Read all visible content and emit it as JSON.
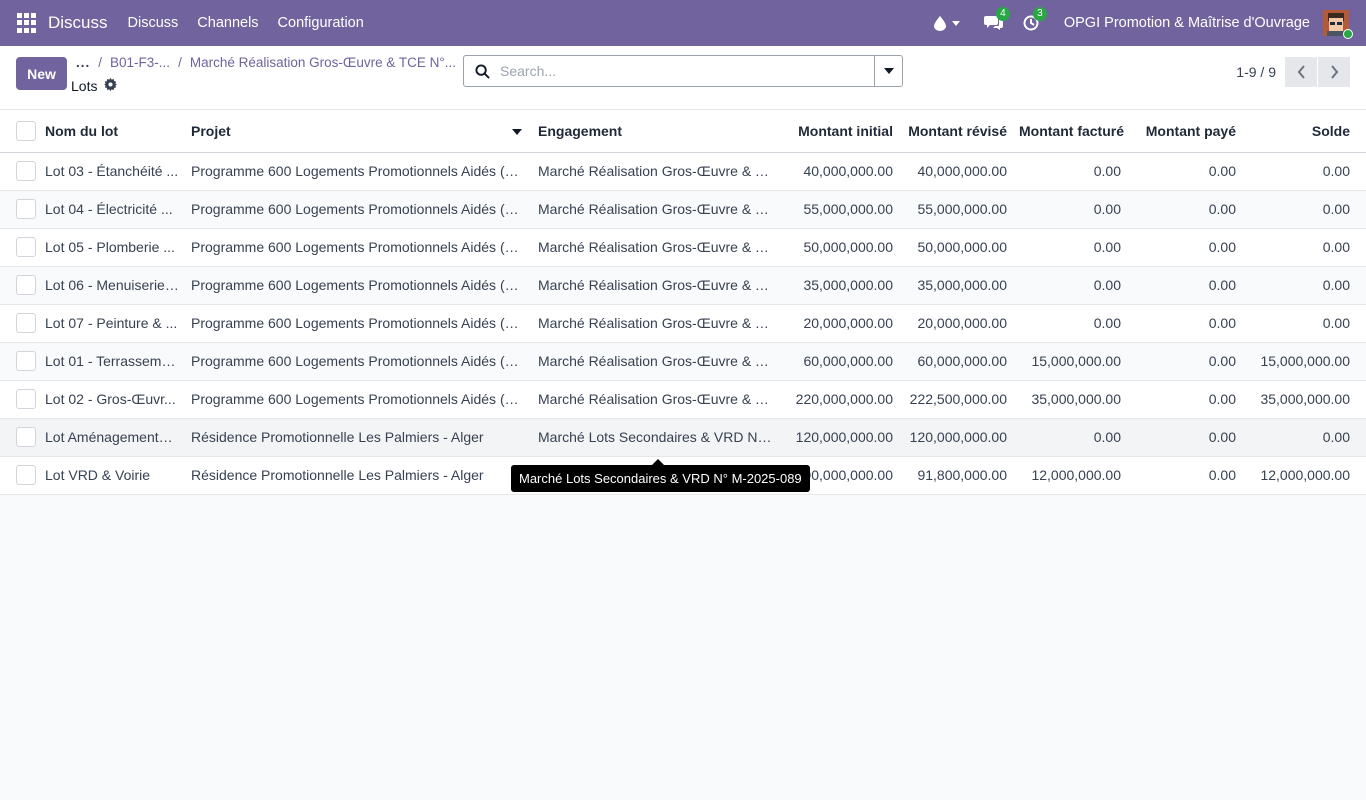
{
  "navbar": {
    "brand": "Discuss",
    "menu": [
      "Discuss",
      "Channels",
      "Configuration"
    ],
    "messages_count": "4",
    "activities_count": "3",
    "company": "OPGI Promotion & Maîtrise d'Ouvrage",
    "colors": {
      "bar": "#71639e",
      "badge": "#28a745"
    }
  },
  "control_panel": {
    "new_label": "New",
    "breadcrumb": {
      "ellipsis": "...",
      "item1": "B01-F3-...",
      "item2": "Marché Réalisation Gros-Œuvre & TCE N°..."
    },
    "view_title": "Lots",
    "search_placeholder": "Search...",
    "pager_value": "1-9 / 9"
  },
  "table": {
    "headers": [
      "Nom du lot",
      "Projet",
      "Engagement",
      "Montant initial",
      "Montant révisé",
      "Montant facturé",
      "Montant payé",
      "Solde"
    ],
    "rows": [
      [
        "Lot 03 - Étanchéité ...",
        "Programme 600 Logements Promotionnels Aidés (LP...",
        "Marché Réalisation Gros-Œuvre & TC...",
        "40,000,000.00",
        "40,000,000.00",
        "0.00",
        "0.00",
        "0.00"
      ],
      [
        "Lot 04 - Électricité ...",
        "Programme 600 Logements Promotionnels Aidés (LP...",
        "Marché Réalisation Gros-Œuvre & TC...",
        "55,000,000.00",
        "55,000,000.00",
        "0.00",
        "0.00",
        "0.00"
      ],
      [
        "Lot 05 - Plomberie ...",
        "Programme 600 Logements Promotionnels Aidés (LP...",
        "Marché Réalisation Gros-Œuvre & TC...",
        "50,000,000.00",
        "50,000,000.00",
        "0.00",
        "0.00",
        "0.00"
      ],
      [
        "Lot 06 - Menuiserie ...",
        "Programme 600 Logements Promotionnels Aidés (LP...",
        "Marché Réalisation Gros-Œuvre & TC...",
        "35,000,000.00",
        "35,000,000.00",
        "0.00",
        "0.00",
        "0.00"
      ],
      [
        "Lot 07 - Peinture & ...",
        "Programme 600 Logements Promotionnels Aidés (LP...",
        "Marché Réalisation Gros-Œuvre & TC...",
        "20,000,000.00",
        "20,000,000.00",
        "0.00",
        "0.00",
        "0.00"
      ],
      [
        "Lot 01 - Terrasseme...",
        "Programme 600 Logements Promotionnels Aidés (LP...",
        "Marché Réalisation Gros-Œuvre & TC...",
        "60,000,000.00",
        "60,000,000.00",
        "15,000,000.00",
        "0.00",
        "15,000,000.00"
      ],
      [
        "Lot 02 - Gros-Œuvr...",
        "Programme 600 Logements Promotionnels Aidés (LP...",
        "Marché Réalisation Gros-Œuvre & TC...",
        "220,000,000.00",
        "222,500,000.00",
        "35,000,000.00",
        "0.00",
        "35,000,000.00"
      ],
      [
        "Lot Aménagements ...",
        "Résidence Promotionnelle Les Palmiers - Alger",
        "Marché Lots Secondaires & VRD N° ...",
        "120,000,000.00",
        "120,000,000.00",
        "0.00",
        "0.00",
        "0.00"
      ],
      [
        "Lot VRD & Voirie",
        "Résidence Promotionnelle Les Palmiers - Alger",
        "",
        "90,000,000.00",
        "91,800,000.00",
        "12,000,000.00",
        "0.00",
        "12,000,000.00"
      ]
    ]
  },
  "tooltip": "Marché Lots Secondaires & VRD N° M-2025-089"
}
